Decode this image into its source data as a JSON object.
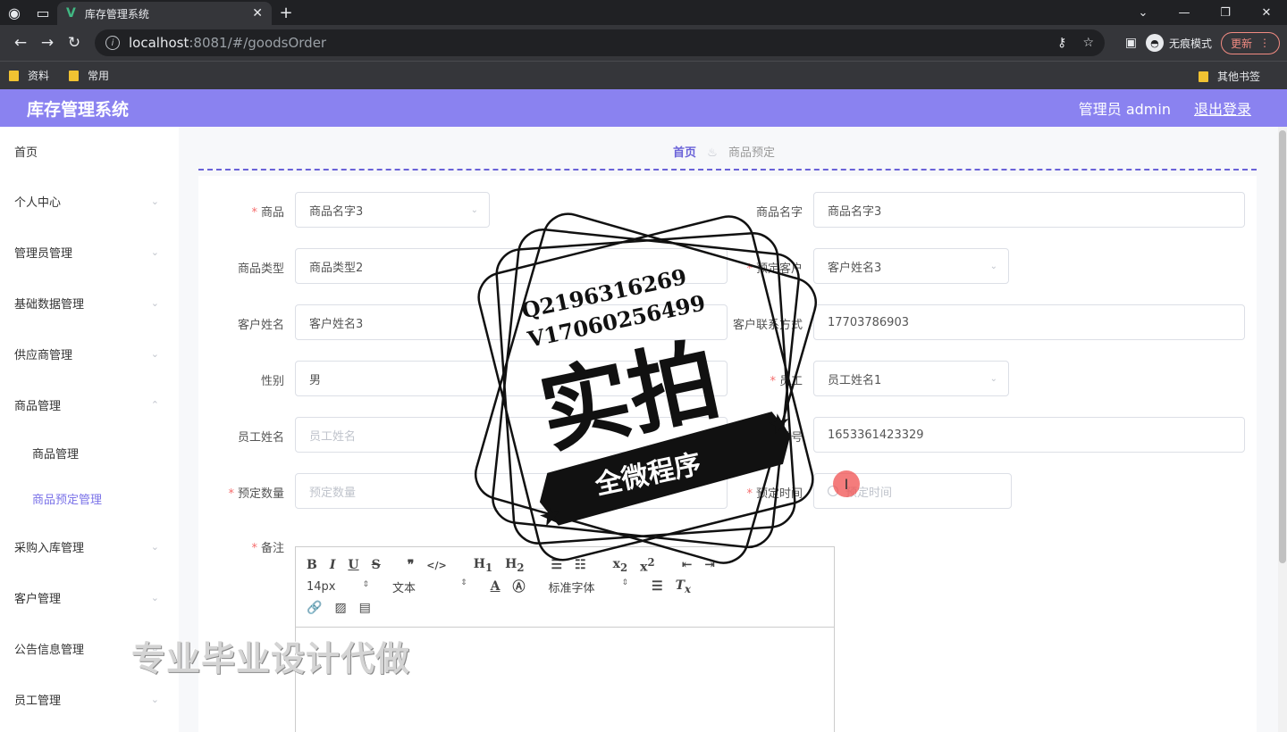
{
  "browser": {
    "tab_title": "库存管理系统",
    "url_host": "localhost",
    "url_rest": ":8081/#/goodsOrder",
    "incognito_label": "无痕模式",
    "update_label": "更新",
    "bookmarks": [
      "资料",
      "常用"
    ],
    "other_bookmarks": "其他书签"
  },
  "header": {
    "title": "库存管理系统",
    "user": "管理员 admin",
    "logout": "退出登录"
  },
  "sidebar": {
    "items": [
      {
        "label": "首页"
      },
      {
        "label": "个人中心"
      },
      {
        "label": "管理员管理"
      },
      {
        "label": "基础数据管理"
      },
      {
        "label": "供应商管理"
      },
      {
        "label": "商品管理"
      },
      {
        "label": "商品管理"
      },
      {
        "label": "商品预定管理"
      },
      {
        "label": "采购入库管理"
      },
      {
        "label": "客户管理"
      },
      {
        "label": "公告信息管理"
      },
      {
        "label": "员工管理"
      }
    ]
  },
  "breadcrumb": {
    "home": "首页",
    "current": "商品预定"
  },
  "form": {
    "goods_label": "商品",
    "goods_value": "商品名字3",
    "goods_name_label": "商品名字",
    "goods_name_value": "商品名字3",
    "goods_type_label": "商品类型",
    "goods_type_value": "商品类型2",
    "customer_label": "预定客户",
    "customer_value": "客户姓名3",
    "customer_name_label": "客户姓名",
    "customer_name_value": "客户姓名3",
    "contact_label": "客户联系方式",
    "contact_value": "17703786903",
    "gender_label": "性别",
    "gender_value": "男",
    "staff_label": "员工",
    "staff_value": "员工姓名1",
    "staff_name_label": "员工姓名",
    "staff_name_placeholder": "员工姓名",
    "order_no_label": "单号",
    "order_no_value": "1653361423329",
    "qty_label": "预定数量",
    "qty_placeholder": "预定数量",
    "time_label": "预定时间",
    "time_placeholder": "预定时间",
    "remark_label": "备注"
  },
  "editor": {
    "font_size": "14px",
    "block_type": "文本",
    "font_family": "标准字体"
  },
  "overlay": {
    "stamp_line1": "Q2196316269",
    "stamp_line2": "V17060256499",
    "stamp_main": "实拍",
    "stamp_banner": "全微程序",
    "watermark": "专业毕业设计代做"
  }
}
